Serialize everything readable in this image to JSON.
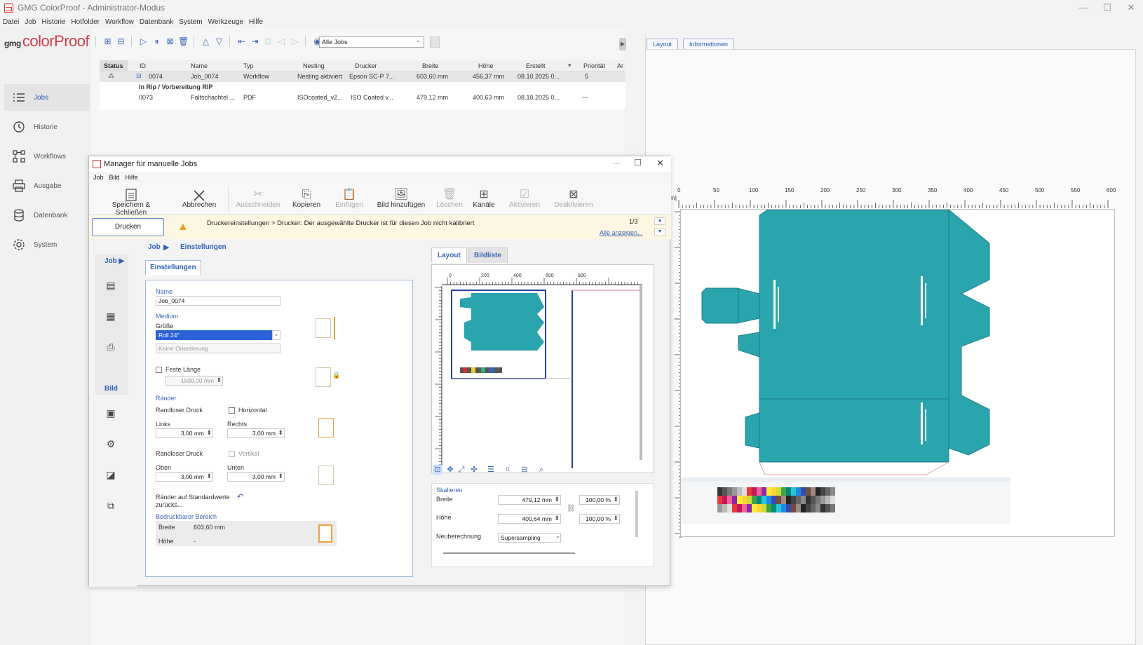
{
  "window": {
    "title": "GMG ColorProof - Administrator-Modus",
    "minimize": "—",
    "maximize": "☐",
    "close": "✕"
  },
  "menu": [
    "Datei",
    "Job",
    "Historie",
    "Hotfolder",
    "Workflow",
    "Datenbank",
    "System",
    "Werkzeuge",
    "Hilfe"
  ],
  "brand": {
    "prefix": "gmg",
    "name": "colorProof"
  },
  "nav": [
    {
      "label": "Jobs",
      "icon": "list-icon",
      "active": true
    },
    {
      "label": "Historie",
      "icon": "history-icon"
    },
    {
      "label": "Workflows",
      "icon": "workflow-icon"
    },
    {
      "label": "Ausgabe",
      "icon": "printer-icon"
    },
    {
      "label": "Datenbank",
      "icon": "database-icon"
    },
    {
      "label": "System",
      "icon": "gear-icon"
    }
  ],
  "toolbar": {
    "filter": "Alle Jobs"
  },
  "table": {
    "headers": [
      "Status",
      "ID",
      "Name",
      "Typ",
      "Nesting",
      "Drucker",
      "Breite",
      "Höhe",
      "Erstellt",
      "Priorität",
      "Ar"
    ],
    "rows": [
      [
        "",
        "0074",
        "Job_0074",
        "Workflow",
        "Nesting aktiviert",
        "Epson SC-P 7...",
        "603,60 mm",
        "456,37 mm",
        "08.10.2025 0...",
        "5",
        ""
      ]
    ],
    "group": "In Rip / Vorbereitung RIP",
    "rows2": [
      [
        "",
        "0073",
        "Faltschachtel ...",
        "PDF",
        "ISOcoated_v2...",
        "ISO Coated v...",
        "479,12 mm",
        "400,63 mm",
        "08.10.2025 0...",
        "---",
        ""
      ]
    ]
  },
  "right": {
    "tabs": [
      "Layout",
      "Informationen"
    ],
    "ruler": [
      "0",
      "50",
      "100",
      "150",
      "200",
      "250",
      "300",
      "350",
      "400",
      "450",
      "500",
      "550",
      "600"
    ],
    "unit": "m]"
  },
  "dialog": {
    "title": "Manager für manuelle Jobs",
    "menu": [
      "Job",
      "Bild",
      "Hilfe"
    ],
    "ribbon": [
      {
        "label": "Speichern & Schließen",
        "icon": "save-icon",
        "enabled": true
      },
      {
        "label": "Abbrechen",
        "icon": "cancel-icon",
        "enabled": true
      },
      {
        "label": "Ausschneiden",
        "icon": "cut-icon",
        "enabled": false
      },
      {
        "label": "Kopieren",
        "icon": "copy-icon",
        "enabled": true
      },
      {
        "label": "Einfügen",
        "icon": "paste-icon",
        "enabled": false
      },
      {
        "label": "Bild hinzufügen",
        "icon": "add-image-icon",
        "enabled": true
      },
      {
        "label": "Löschen",
        "icon": "delete-icon",
        "enabled": false
      },
      {
        "label": "Kanäle",
        "icon": "channels-icon",
        "enabled": true
      },
      {
        "label": "Aktivieren",
        "icon": "activate-icon",
        "enabled": false
      },
      {
        "label": "Deaktivieren",
        "icon": "deactivate-icon",
        "enabled": false
      }
    ],
    "drucken": "Drucken",
    "warning": "Druckereinstellungen > Drucker: Der ausgewählte Drucker ist für diesen Job nicht kalibriert",
    "warn_count": "1/3",
    "warn_all": "Alle anzeigen...",
    "breadcrumb": [
      "Job",
      "Einstellungen"
    ],
    "side": {
      "job": "Job",
      "bild": "Bild"
    },
    "tab": "Einstellungen",
    "form": {
      "name_label": "Name",
      "name_value": "Job_0074",
      "medium": "Medium",
      "groesse": "Größe",
      "groesse_value": "Roll 24\"",
      "orientation": "Keine Orientierung",
      "feste_laenge": "Feste Länge",
      "feste_laenge_value": "1500,00 mm",
      "raender": "Ränder",
      "randlos": "Randloser Druck",
      "horizontal": "Horizontal",
      "links": "Links",
      "links_value": "3,00 mm",
      "rechts": "Rechts",
      "rechts_value": "3,00 mm",
      "randlos2": "Randloser Druck",
      "vertikal": "Vertikal",
      "oben": "Oben",
      "oben_value": "3,00 mm",
      "unten": "Unten",
      "unten_value": "3,00 mm",
      "reset": "Ränder auf Standardwerte zurücks...",
      "bedruckbar": "Bedruckbarer Bereich",
      "breite": "Breite",
      "breite_value": "603,60 mm",
      "hoehe": "Höhe",
      "hoehe_value": "-"
    },
    "layout_tabs": [
      "Layout",
      "Bildliste"
    ],
    "mini_ruler": [
      "0",
      "200",
      "400",
      "600",
      "800"
    ],
    "scale": {
      "title": "Skalieren",
      "breite": "Breite",
      "breite_value": "479,12 mm",
      "breite_pct": "100,00 %",
      "hoehe": "Höhe",
      "hoehe_value": "400,64 mm",
      "hoehe_pct": "100,00 %",
      "neuberechnung": "Neuberechnung",
      "neuberechnung_value": "Supersampling"
    }
  },
  "colors": {
    "accent": "#2b62b5",
    "box": "#2aa4ad",
    "warnbg": "#fdf6e3"
  }
}
